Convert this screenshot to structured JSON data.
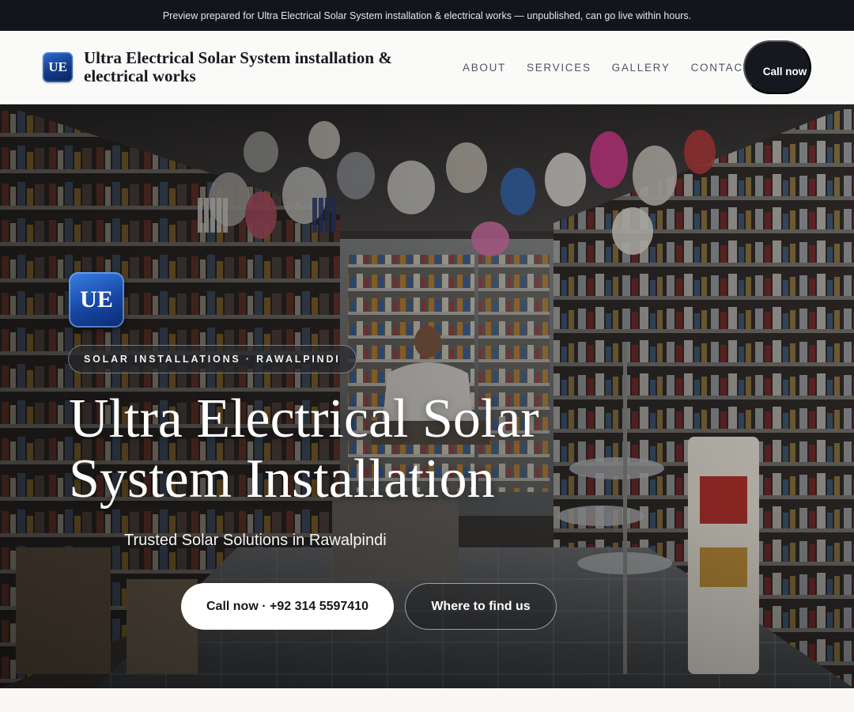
{
  "preview_banner": "Preview prepared for Ultra Electrical Solar System installation & electrical works — unpublished, can go live within hours.",
  "header": {
    "logo_text": "UE",
    "brand": "Ultra Electrical Solar System installation & electrical works",
    "nav": [
      "ABOUT",
      "SERVICES",
      "GALLERY",
      "CONTACT"
    ],
    "call_button": "Call now"
  },
  "hero": {
    "logo_text": "UE",
    "tag": "SOLAR INSTALLATIONS · RAWALPINDI",
    "title": "Ultra Electrical Solar System Installation",
    "subtitle": "Trusted Solar Solutions in Rawalpindi",
    "primary_button": "Call now · +92 314 5597410",
    "secondary_button": "Where to find us"
  },
  "colors": {
    "top_banner_bg": "#12151b",
    "nav_bg": "#fafaf8",
    "accent_blue": "#1747a5",
    "call_button_bg": "#16181f"
  },
  "icons": {
    "brand_logo": "ue-monogram-logo"
  }
}
